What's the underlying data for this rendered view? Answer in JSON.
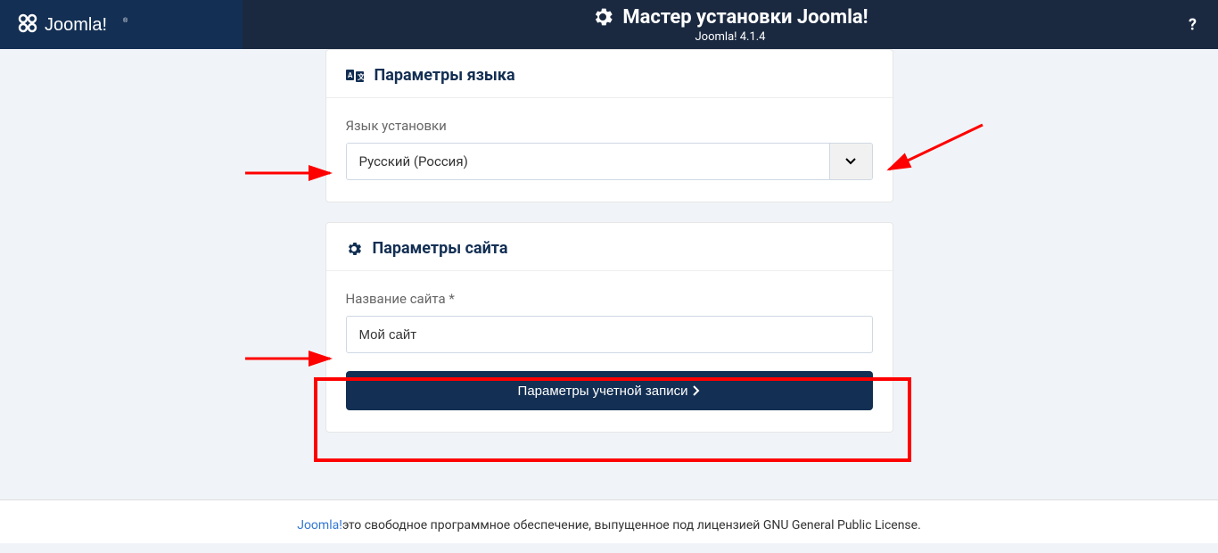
{
  "header": {
    "logo_text": "Joomla!",
    "title": "Мастер установки Joomla!",
    "version": "Joomla! 4.1.4",
    "help_tooltip": "?"
  },
  "card_language": {
    "title": "Параметры языка",
    "field_label": "Язык установки",
    "selected_value": "Русский (Россия)"
  },
  "card_site": {
    "title": "Параметры сайта",
    "field_label": "Название сайта *",
    "input_value": "Мой сайт",
    "button_label": "Параметры учетной записи"
  },
  "footer": {
    "link_text": "Joomla!",
    "text": "это свободное программное обеспечение, выпущенное под лицензией GNU General Public License."
  }
}
